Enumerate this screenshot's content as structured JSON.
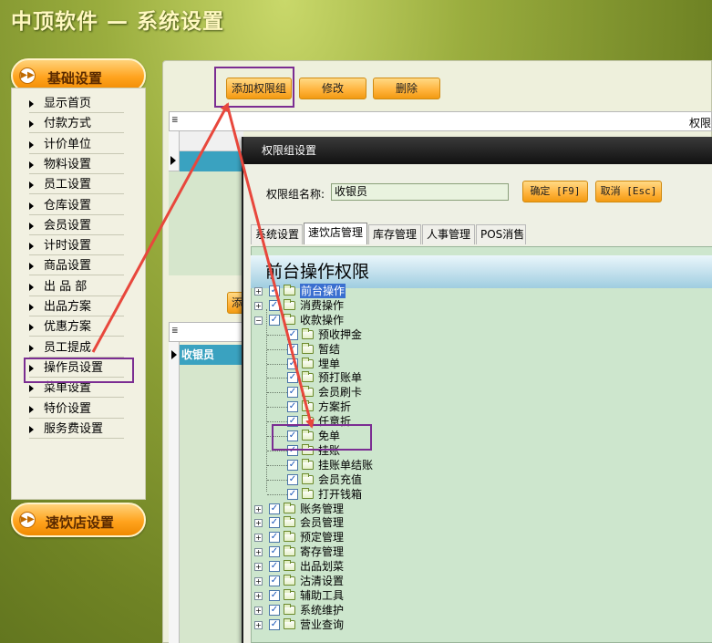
{
  "app_title": "中顶软件 — 系统设置",
  "sidebar": {
    "header": "基础设置",
    "items": [
      "显示首页",
      "付款方式",
      "计价单位",
      "物料设置",
      "员工设置",
      "仓库设置",
      "会员设置",
      "计时设置",
      "商品设置",
      "出 品 部",
      "出品方案",
      "优惠方案",
      "员工提成",
      "操作员设置",
      "菜单设置",
      "特价设置",
      "服务费设置"
    ],
    "footer": "速饮店设置"
  },
  "toolbar": {
    "add_group": "添加权限组",
    "modify": "修改",
    "delete": "删除"
  },
  "grid_top": {
    "header_cut": "权限"
  },
  "grid_bottom": {
    "row1": "收银员",
    "add_btn_cut": "添"
  },
  "dialog": {
    "title": "权限组设置",
    "name_label": "权限组名称:",
    "name_value": "收银员",
    "ok_btn": "确定 [F9]",
    "cancel_btn": "取消 [Esc]",
    "tabs": [
      "系统设置",
      "速饮店管理",
      "库存管理",
      "人事管理",
      "POS消售"
    ],
    "active_tab": "速饮店管理",
    "tree_title": "前台操作权限",
    "tree": [
      {
        "label": "前台操作",
        "level": 0,
        "expanded": false,
        "checked": true,
        "selected": true
      },
      {
        "label": "消费操作",
        "level": 0,
        "expanded": false,
        "checked": true
      },
      {
        "label": "收款操作",
        "level": 0,
        "expanded": true,
        "checked": true
      },
      {
        "label": "预收押金",
        "level": 1,
        "checked": true
      },
      {
        "label": "暂结",
        "level": 1,
        "checked": true
      },
      {
        "label": "埋单",
        "level": 1,
        "checked": true
      },
      {
        "label": "预打账单",
        "level": 1,
        "checked": true
      },
      {
        "label": "会员刷卡",
        "level": 1,
        "checked": true
      },
      {
        "label": "方案折",
        "level": 1,
        "checked": true
      },
      {
        "label": "任意折",
        "level": 1,
        "checked": true
      },
      {
        "label": "免单",
        "level": 1,
        "checked": true
      },
      {
        "label": "挂账",
        "level": 1,
        "checked": true
      },
      {
        "label": "挂账单结账",
        "level": 1,
        "checked": true
      },
      {
        "label": "会员充值",
        "level": 1,
        "checked": true
      },
      {
        "label": "打开钱箱",
        "level": 1,
        "checked": true
      },
      {
        "label": "账务管理",
        "level": 0,
        "expanded": false,
        "checked": true
      },
      {
        "label": "会员管理",
        "level": 0,
        "expanded": false,
        "checked": true
      },
      {
        "label": "预定管理",
        "level": 0,
        "expanded": false,
        "checked": true
      },
      {
        "label": "寄存管理",
        "level": 0,
        "expanded": false,
        "checked": true
      },
      {
        "label": "出品划菜",
        "level": 0,
        "expanded": false,
        "checked": true
      },
      {
        "label": "沽清设置",
        "level": 0,
        "expanded": false,
        "checked": true
      },
      {
        "label": "辅助工具",
        "level": 0,
        "expanded": false,
        "checked": true
      },
      {
        "label": "系统维护",
        "level": 0,
        "expanded": false,
        "checked": true
      },
      {
        "label": "营业查询",
        "level": 0,
        "expanded": false,
        "checked": true
      }
    ]
  },
  "colors": {
    "accent_orange": "#ffa31e",
    "highlight_box": "#7b2d92",
    "arrow": "#e8473c",
    "selected_row": "#3aa2c0"
  }
}
